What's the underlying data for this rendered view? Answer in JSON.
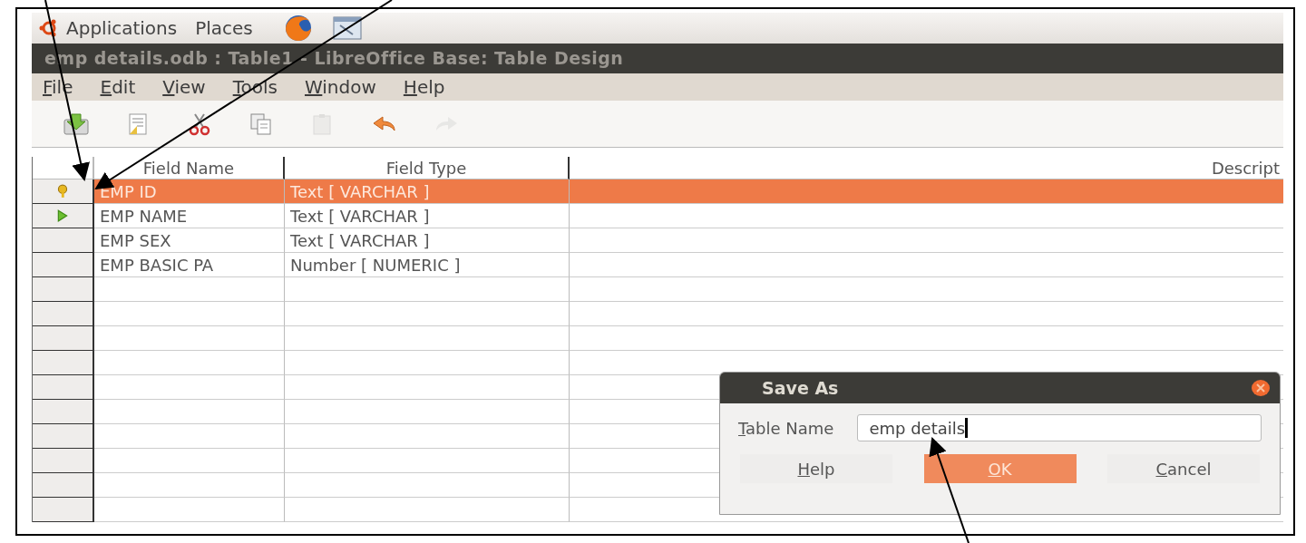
{
  "panel": {
    "items": [
      "Applications",
      "Places"
    ]
  },
  "window": {
    "title": "emp details.odb : Table1 - LibreOffice Base: Table Design"
  },
  "menu": [
    "File",
    "Edit",
    "View",
    "Tools",
    "Window",
    "Help"
  ],
  "toolbar": [
    {
      "kind": "save",
      "disabled": false
    },
    {
      "kind": "edit",
      "disabled": false
    },
    {
      "kind": "cut",
      "disabled": false
    },
    {
      "kind": "copy",
      "disabled": false
    },
    {
      "kind": "paste",
      "disabled": true
    },
    {
      "kind": "undo",
      "disabled": false
    },
    {
      "kind": "redo",
      "disabled": true
    }
  ],
  "table": {
    "columns": [
      "Field Name",
      "Field Type",
      "Descript"
    ],
    "rows": [
      {
        "primary_key": true,
        "current": false,
        "selected": true,
        "name": "EMP ID",
        "type": "Text [ VARCHAR ]"
      },
      {
        "primary_key": false,
        "current": true,
        "selected": false,
        "name": "EMP NAME",
        "type": "Text [ VARCHAR ]"
      },
      {
        "primary_key": false,
        "current": false,
        "selected": false,
        "name": "EMP SEX",
        "type": "Text [ VARCHAR ]"
      },
      {
        "primary_key": false,
        "current": false,
        "selected": false,
        "name": "EMP BASIC PA",
        "type": "Number [ NUMERIC ]"
      }
    ]
  },
  "dialog": {
    "title": "Save As",
    "label": "Table Name",
    "value": "emp details",
    "buttons": [
      {
        "label": "Help",
        "default": false
      },
      {
        "label": "OK",
        "default": true
      },
      {
        "label": "Cancel",
        "default": false
      }
    ]
  }
}
